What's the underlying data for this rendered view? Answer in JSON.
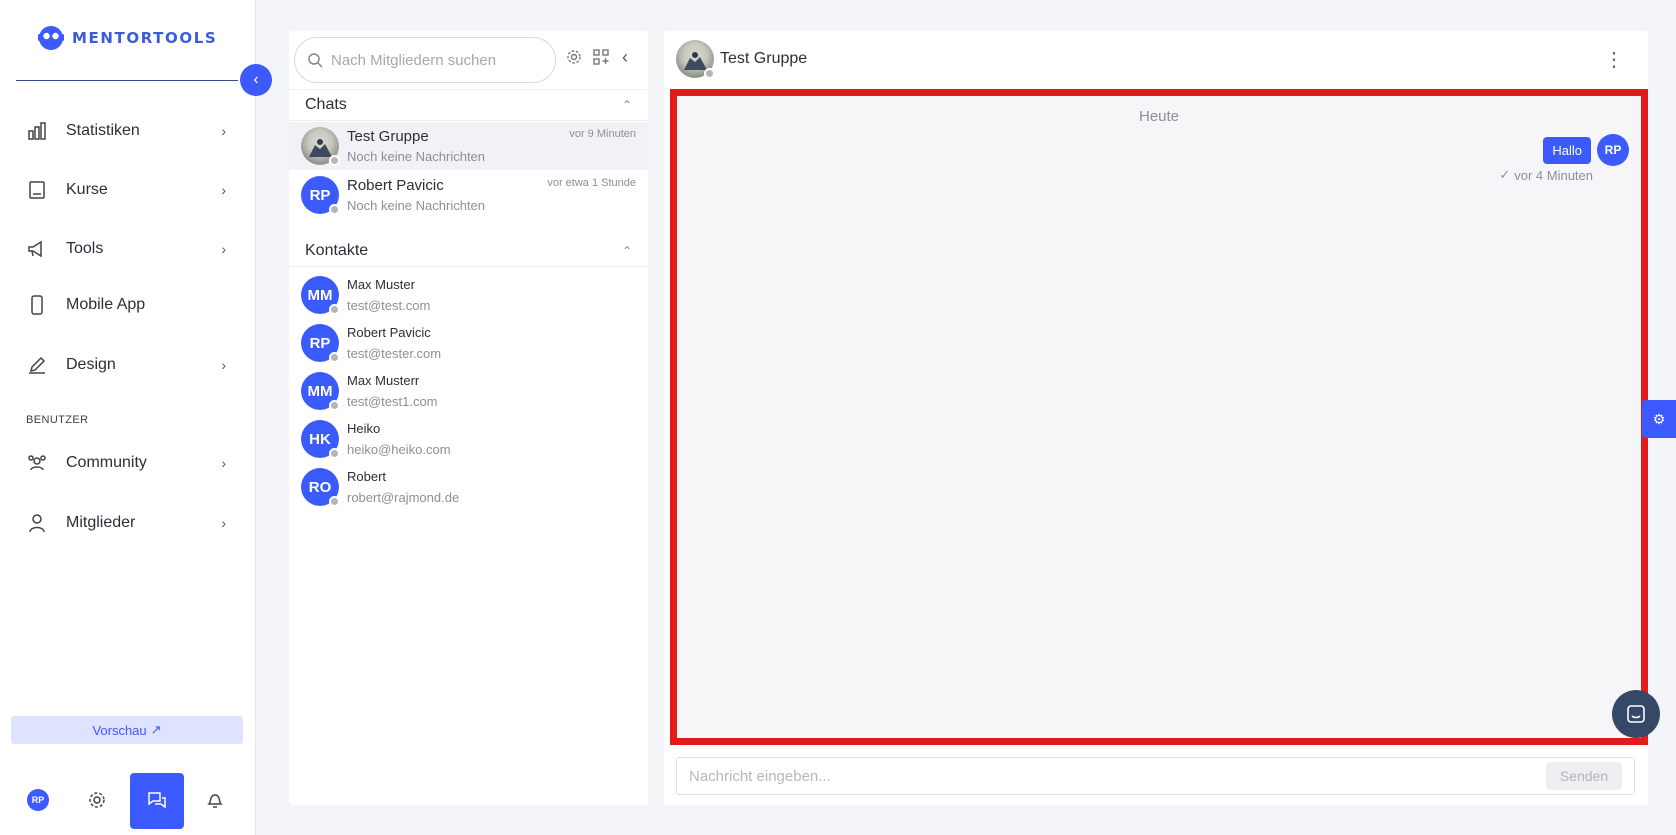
{
  "brand": {
    "name": "MENTORTOOLS"
  },
  "sidebar": {
    "items": [
      {
        "label": "Statistiken",
        "icon": "bar-chart-icon"
      },
      {
        "label": "Kurse",
        "icon": "book-icon"
      },
      {
        "label": "Tools",
        "icon": "megaphone-icon"
      },
      {
        "label": "Mobile App",
        "icon": "mobile-icon"
      },
      {
        "label": "Design",
        "icon": "edit-icon"
      },
      {
        "label": "Community",
        "icon": "people-icon"
      },
      {
        "label": "Mitglieder",
        "icon": "user-icon"
      }
    ],
    "section_label": "BENUTZER",
    "preview_label": "Vorschau",
    "bottom": {
      "avatar": "RP"
    }
  },
  "members": {
    "search_placeholder": "Nach Mitgliedern suchen",
    "chats_title": "Chats",
    "contacts_title": "Kontakte",
    "chats": [
      {
        "name": "Test Gruppe",
        "sub": "Noch keine Nachrichten",
        "time": "vor 9 Minuten"
      },
      {
        "name": "Robert Pavicic",
        "initials": "RP",
        "sub": "Noch keine Nachrichten",
        "time": "vor etwa 1 Stunde"
      }
    ],
    "contacts": [
      {
        "initials": "MM",
        "name": "Max Muster",
        "email": "test@test.com"
      },
      {
        "initials": "RP",
        "name": "Robert Pavicic",
        "email": "test@tester.com"
      },
      {
        "initials": "MM",
        "name": "Max Musterr",
        "email": "test@test1.com"
      },
      {
        "initials": "HK",
        "name": "Heiko",
        "email": "heiko@heiko.com"
      },
      {
        "initials": "RO",
        "name": "Robert",
        "email": "robert@rajmond.de"
      }
    ]
  },
  "chat": {
    "title": "Test Gruppe",
    "date_separator": "Heute",
    "messages": [
      {
        "text": "Hallo",
        "avatar": "RP",
        "meta": "vor 4 Minuten"
      }
    ],
    "composer_placeholder": "Nachricht eingeben...",
    "send_label": "Senden"
  },
  "colors": {
    "accent": "#3d5afe",
    "highlight_border": "#e31b1b"
  }
}
